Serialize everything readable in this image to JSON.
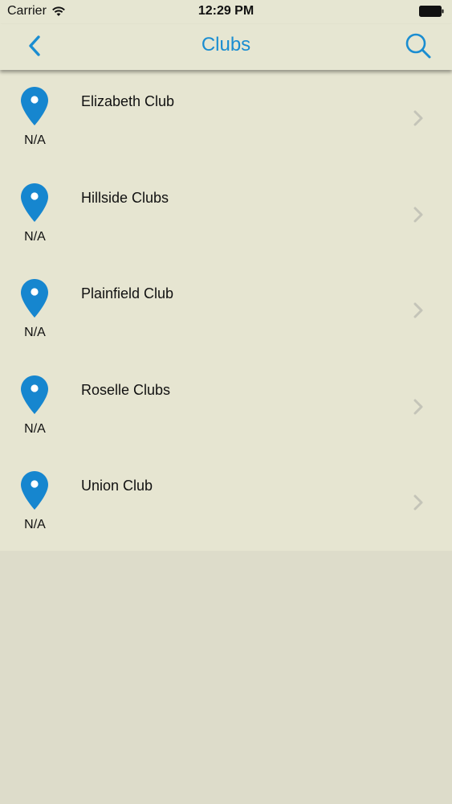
{
  "status_bar": {
    "carrier": "Carrier",
    "time": "12:29 PM",
    "wifi_icon": "wifi-icon",
    "battery_icon": "battery-icon"
  },
  "nav": {
    "title": "Clubs",
    "back_icon": "chevron-left-icon",
    "search_icon": "search-icon"
  },
  "clubs": [
    {
      "name": "Elizabeth Club",
      "distance": "N/A"
    },
    {
      "name": "Hillside Clubs",
      "distance": "N/A"
    },
    {
      "name": "Plainfield Club",
      "distance": "N/A"
    },
    {
      "name": "Roselle Clubs",
      "distance": "N/A"
    },
    {
      "name": "Union Club",
      "distance": "N/A"
    }
  ],
  "colors": {
    "accent": "#1a8dd1",
    "pin": "#1686cf",
    "chevron": "#c4c4b8",
    "bar_background": "#e6e6d2",
    "page_background": "#dddcca"
  }
}
